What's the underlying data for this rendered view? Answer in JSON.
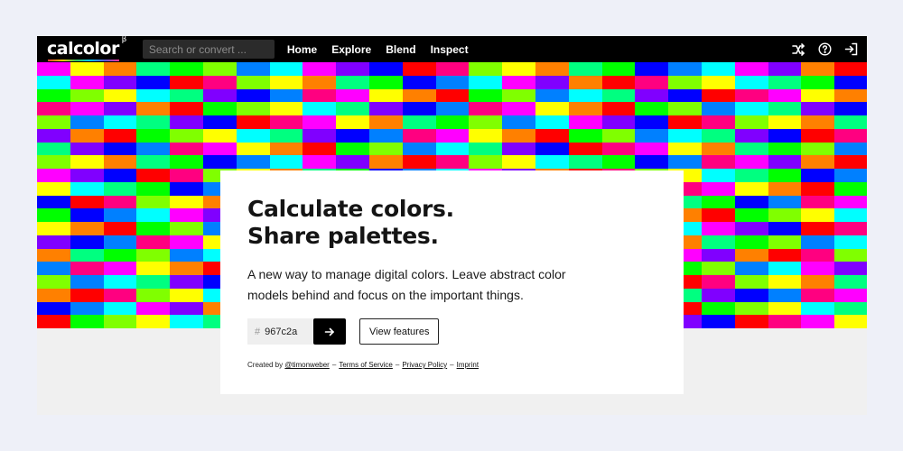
{
  "nav": {
    "logo_text": "calcolor",
    "logo_superscript": "β",
    "search_placeholder": "Search or convert ...",
    "links": [
      "Home",
      "Explore",
      "Blend",
      "Inspect"
    ],
    "icons": [
      "shuffle-icon",
      "help-icon",
      "sign-in-icon"
    ]
  },
  "hero": {
    "headline_line1": "Calculate colors.",
    "headline_line2": "Share palettes.",
    "description": "A new way to manage digital colors. Leave abstract color models behind and focus on the important things.",
    "hex_prefix": "#",
    "hex_value": "967c2a",
    "features_label": "View features"
  },
  "footer": {
    "created_by": "Created by",
    "author": "@timonweber",
    "dash": "–",
    "terms": "Terms of Service",
    "privacy": "Privacy Policy",
    "imprint": "Imprint"
  },
  "colors": {
    "navbar": "#000000",
    "mosaic_palette": [
      "#ff00ff",
      "#ff0080",
      "#ff0000",
      "#ff8000",
      "#ffff00",
      "#80ff00",
      "#00ff00",
      "#00ff80",
      "#00ffff",
      "#0080ff",
      "#0000ff",
      "#8000ff"
    ]
  }
}
